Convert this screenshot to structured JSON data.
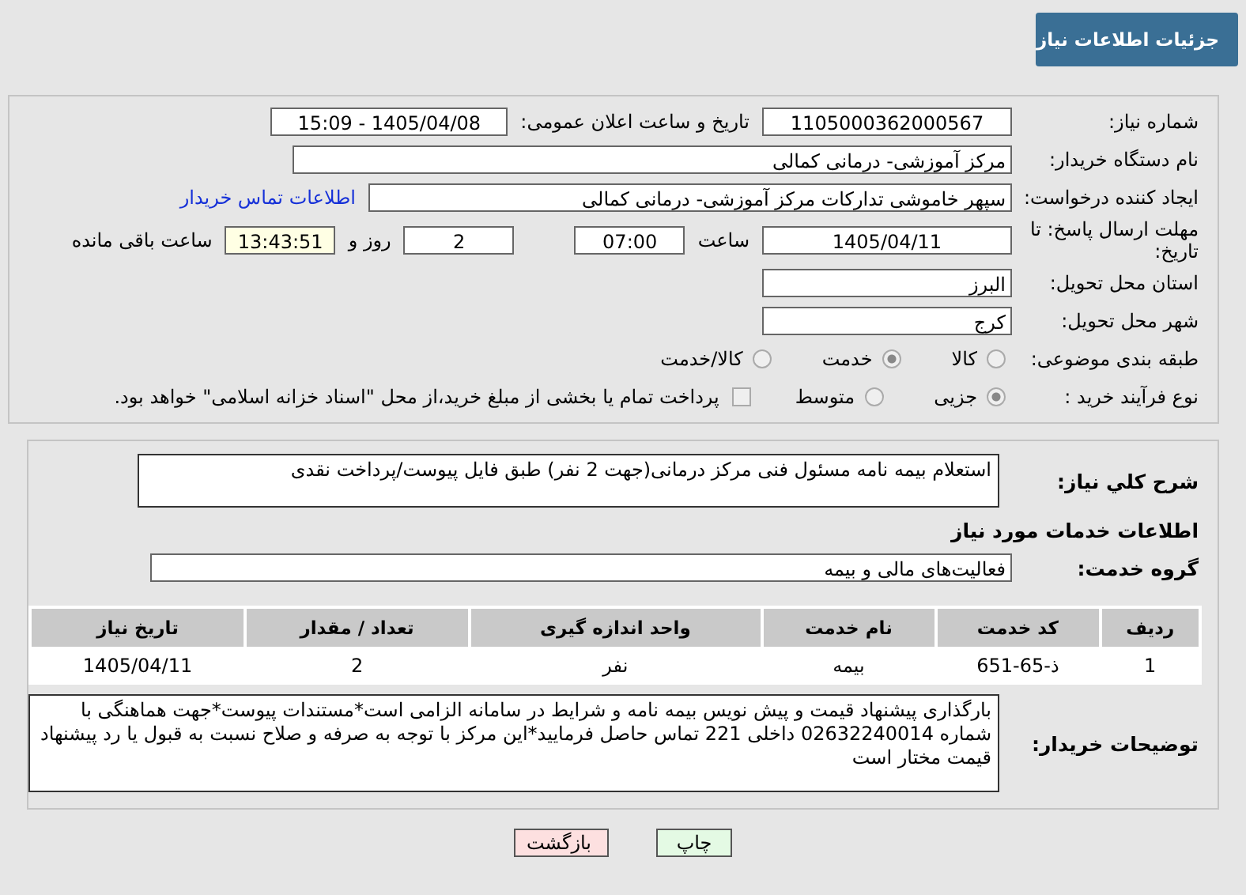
{
  "header": {
    "title": "جزئیات اطلاعات نیاز"
  },
  "details": {
    "need_number": {
      "label": "شماره نیاز:",
      "value": "1105000362000567"
    },
    "announce": {
      "label": "تاریخ و ساعت اعلان عمومی:",
      "value": "1405/04/08 - 15:09"
    },
    "buyer": {
      "label": "نام دستگاه خریدار:",
      "value": "مرکز آموزشی- درمانی کمالی"
    },
    "creator": {
      "label": "ایجاد کننده درخواست:",
      "value": "سپهر خاموشی تدارکات مرکز آموزشی- درمانی کمالی",
      "link": "اطلاعات تماس خریدار"
    },
    "deadline": {
      "label": "مهلت ارسال پاسخ: تا تاریخ:",
      "date": "1405/04/11",
      "time_label": "ساعت",
      "time": "07:00",
      "days": "2",
      "days_label": "روز و",
      "remaining": "13:43:51",
      "remaining_label": "ساعت باقی مانده"
    },
    "province": {
      "label": "استان محل تحویل:",
      "value": "البرز"
    },
    "city": {
      "label": "شهر محل تحویل:",
      "value": "کرج"
    },
    "category": {
      "label": "طبقه بندی موضوعی:",
      "options": [
        {
          "label": "کالا",
          "selected": false
        },
        {
          "label": "خدمت",
          "selected": true
        },
        {
          "label": "کالا/خدمت",
          "selected": false
        }
      ]
    },
    "process": {
      "label": "نوع فرآیند خرید :",
      "options": [
        {
          "label": "جزیی",
          "selected": true
        },
        {
          "label": "متوسط",
          "selected": false
        }
      ],
      "payment": {
        "label": "پرداخت تمام یا بخشی از مبلغ خرید،از محل \"اسناد خزانه اسلامی\" خواهد بود.",
        "checked": false
      }
    }
  },
  "need": {
    "summary_label": "شرح کلي نیاز:",
    "summary": "استعلام بیمه نامه مسئول فنی مرکز درمانی(جهت 2 نفر) طبق فایل پیوست/پرداخت نقدی",
    "services_heading": "اطلاعات خدمات مورد نیاز",
    "group_label": "گروه خدمت:",
    "group": "فعالیت‌های مالی و بیمه",
    "table": {
      "columns": [
        "ردیف",
        "کد خدمت",
        "نام خدمت",
        "واحد اندازه گیری",
        "تعداد / مقدار",
        "تاریخ نیاز"
      ],
      "rows": [
        [
          "1",
          "ذ-65-651",
          "بیمه",
          "نفر",
          "2",
          "1405/04/11"
        ]
      ]
    },
    "notes_label": "توضیحات خریدار:",
    "notes": "بارگذاری پیشنهاد قیمت و پیش نویس بیمه نامه و شرایط در سامانه الزامی است*مستندات پیوست*جهت هماهنگی با شماره 02632240014 داخلی 221 تماس حاصل فرمایید*این مرکز با توجه به صرفه و صلاح نسبت به قبول یا رد پیشنهاد قیمت مختار است"
  },
  "buttons": [
    {
      "label": "چاپ",
      "kind": "print"
    },
    {
      "label": "بازگشت",
      "kind": "back"
    }
  ]
}
